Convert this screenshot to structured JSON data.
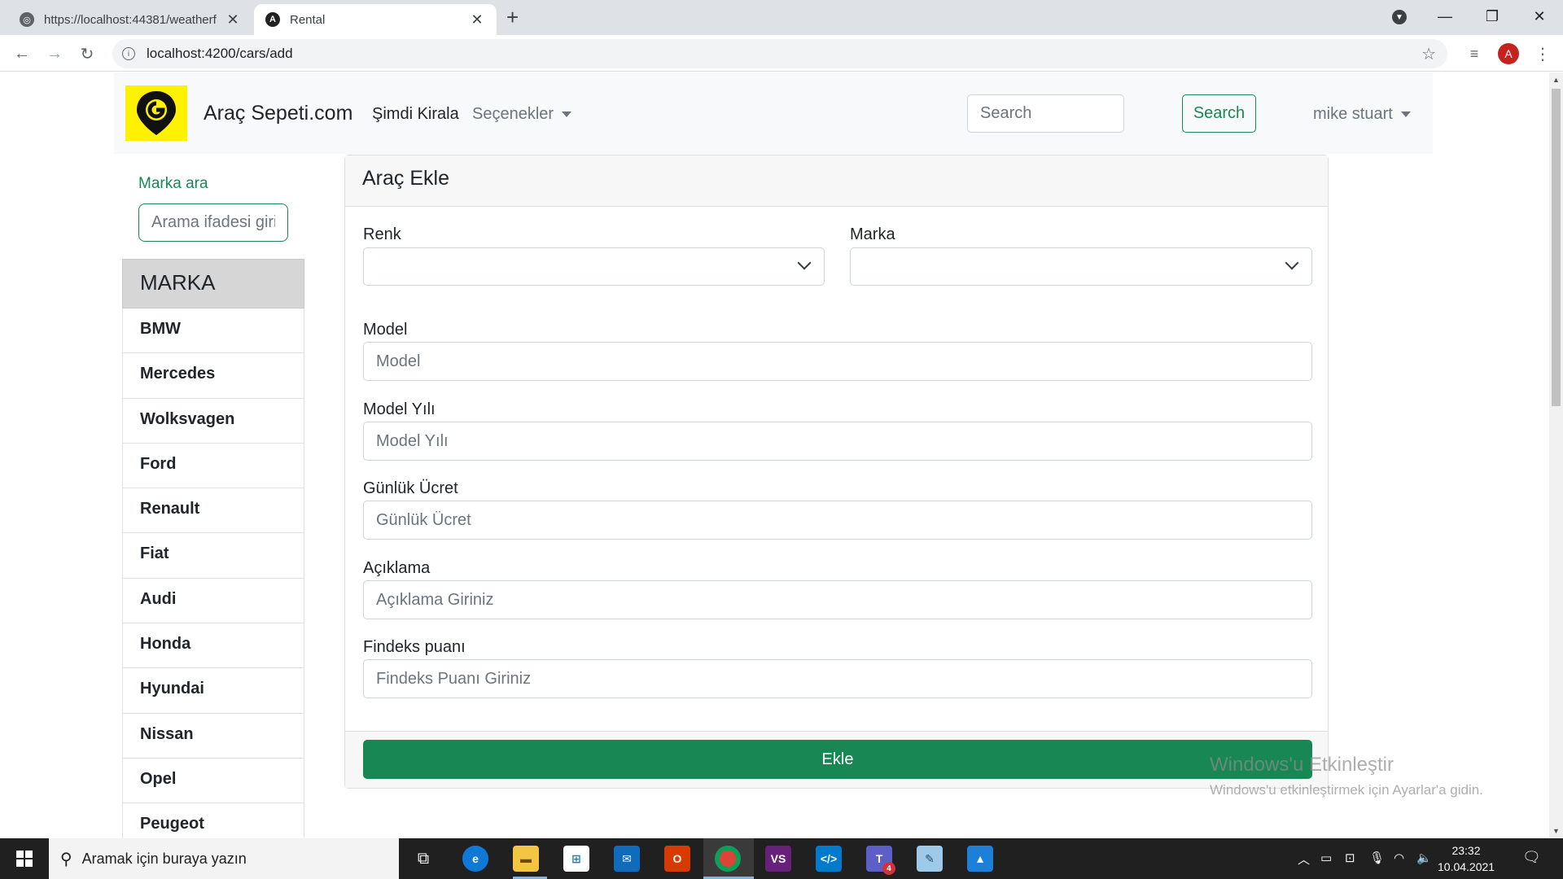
{
  "browser": {
    "tabs": [
      {
        "title": "https://localhost:44381/weatherf"
      },
      {
        "title": "Rental"
      }
    ],
    "url": "localhost:4200/cars/add",
    "profile_initial": "A"
  },
  "navbar": {
    "brand": "Araç Sepeti.com",
    "rent_now": "Şimdi Kirala",
    "options": "Seçenekler",
    "search_placeholder": "Search",
    "search_button": "Search",
    "user": "mike stuart"
  },
  "sidebar": {
    "search_label": "Marka ara",
    "search_placeholder": "Arama ifadesi giri",
    "list_title": "MARKA",
    "brands": [
      "BMW",
      "Mercedes",
      "Wolksvagen",
      "Ford",
      "Renault",
      "Fiat",
      "Audi",
      "Honda",
      "Hyundai",
      "Nissan",
      "Opel",
      "Peugeot"
    ]
  },
  "form": {
    "title": "Araç Ekle",
    "color_label": "Renk",
    "brand_label": "Marka",
    "model_label": "Model",
    "model_placeholder": "Model",
    "year_label": "Model Yılı",
    "year_placeholder": "Model Yılı",
    "price_label": "Günlük Ücret",
    "price_placeholder": "Günlük Ücret",
    "desc_label": "Açıklama",
    "desc_placeholder": "Açıklama Giriniz",
    "findeks_label": "Findeks puanı",
    "findeks_placeholder": "Findeks Puanı Giriniz",
    "submit": "Ekle"
  },
  "watermark": {
    "title": "Windows'u Etkinleştir",
    "subtitle": "Windows'u etkinleştirmek için Ayarlar'a gidin."
  },
  "taskbar": {
    "search_placeholder": "Aramak için buraya yazın",
    "time": "23:32",
    "date": "10.04.2021",
    "notification_badge": "4"
  },
  "colors": {
    "success": "#198754",
    "navbar_bg": "#f8f9fa",
    "logo_bg": "#fff200"
  }
}
